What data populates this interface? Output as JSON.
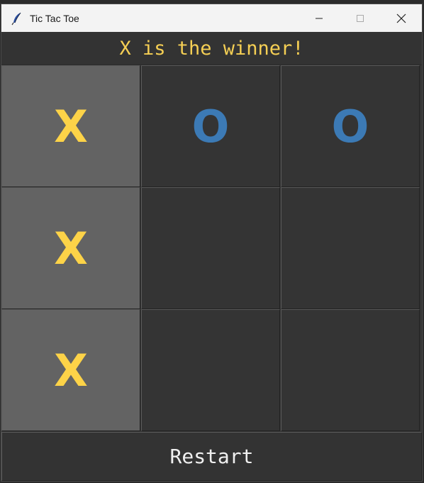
{
  "window": {
    "title": "Tic Tac Toe",
    "icon": "feather-icon",
    "controls": [
      "minimize-icon",
      "maximize-icon",
      "close-icon"
    ]
  },
  "status_text": "X is the winner!",
  "board": [
    {
      "mark": "X",
      "winning": true
    },
    {
      "mark": "O",
      "winning": false
    },
    {
      "mark": "O",
      "winning": false
    },
    {
      "mark": "X",
      "winning": true
    },
    {
      "mark": "",
      "winning": false
    },
    {
      "mark": "",
      "winning": false
    },
    {
      "mark": "X",
      "winning": true
    },
    {
      "mark": "",
      "winning": false
    },
    {
      "mark": "",
      "winning": false
    }
  ],
  "restart_label": "Restart",
  "colors": {
    "x_mark": "#fdd348",
    "o_mark": "#3c7ab5",
    "winning_cell": "#636363",
    "cell_bg": "#343434",
    "status_text": "#f5cf54"
  }
}
